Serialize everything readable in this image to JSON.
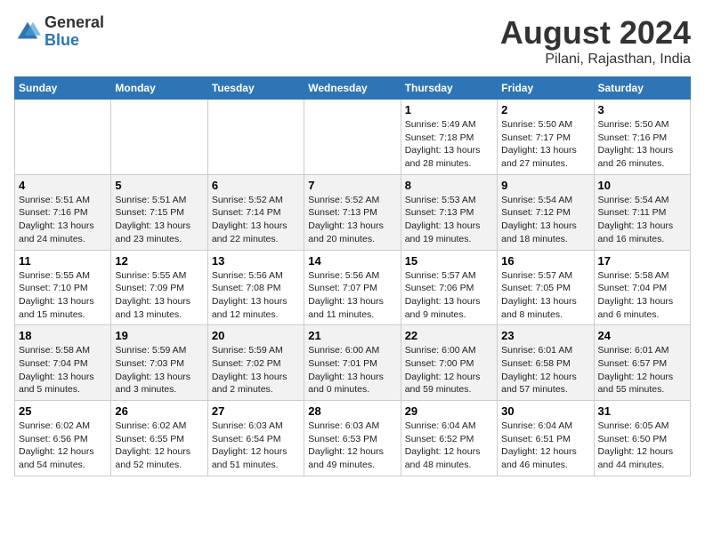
{
  "logo": {
    "general": "General",
    "blue": "Blue"
  },
  "title": "August 2024",
  "subtitle": "Pilani, Rajasthan, India",
  "days_of_week": [
    "Sunday",
    "Monday",
    "Tuesday",
    "Wednesday",
    "Thursday",
    "Friday",
    "Saturday"
  ],
  "weeks": [
    [
      {
        "day": "",
        "content": ""
      },
      {
        "day": "",
        "content": ""
      },
      {
        "day": "",
        "content": ""
      },
      {
        "day": "",
        "content": ""
      },
      {
        "day": "1",
        "content": "Sunrise: 5:49 AM\nSunset: 7:18 PM\nDaylight: 13 hours\nand 28 minutes."
      },
      {
        "day": "2",
        "content": "Sunrise: 5:50 AM\nSunset: 7:17 PM\nDaylight: 13 hours\nand 27 minutes."
      },
      {
        "day": "3",
        "content": "Sunrise: 5:50 AM\nSunset: 7:16 PM\nDaylight: 13 hours\nand 26 minutes."
      }
    ],
    [
      {
        "day": "4",
        "content": "Sunrise: 5:51 AM\nSunset: 7:16 PM\nDaylight: 13 hours\nand 24 minutes."
      },
      {
        "day": "5",
        "content": "Sunrise: 5:51 AM\nSunset: 7:15 PM\nDaylight: 13 hours\nand 23 minutes."
      },
      {
        "day": "6",
        "content": "Sunrise: 5:52 AM\nSunset: 7:14 PM\nDaylight: 13 hours\nand 22 minutes."
      },
      {
        "day": "7",
        "content": "Sunrise: 5:52 AM\nSunset: 7:13 PM\nDaylight: 13 hours\nand 20 minutes."
      },
      {
        "day": "8",
        "content": "Sunrise: 5:53 AM\nSunset: 7:13 PM\nDaylight: 13 hours\nand 19 minutes."
      },
      {
        "day": "9",
        "content": "Sunrise: 5:54 AM\nSunset: 7:12 PM\nDaylight: 13 hours\nand 18 minutes."
      },
      {
        "day": "10",
        "content": "Sunrise: 5:54 AM\nSunset: 7:11 PM\nDaylight: 13 hours\nand 16 minutes."
      }
    ],
    [
      {
        "day": "11",
        "content": "Sunrise: 5:55 AM\nSunset: 7:10 PM\nDaylight: 13 hours\nand 15 minutes."
      },
      {
        "day": "12",
        "content": "Sunrise: 5:55 AM\nSunset: 7:09 PM\nDaylight: 13 hours\nand 13 minutes."
      },
      {
        "day": "13",
        "content": "Sunrise: 5:56 AM\nSunset: 7:08 PM\nDaylight: 13 hours\nand 12 minutes."
      },
      {
        "day": "14",
        "content": "Sunrise: 5:56 AM\nSunset: 7:07 PM\nDaylight: 13 hours\nand 11 minutes."
      },
      {
        "day": "15",
        "content": "Sunrise: 5:57 AM\nSunset: 7:06 PM\nDaylight: 13 hours\nand 9 minutes."
      },
      {
        "day": "16",
        "content": "Sunrise: 5:57 AM\nSunset: 7:05 PM\nDaylight: 13 hours\nand 8 minutes."
      },
      {
        "day": "17",
        "content": "Sunrise: 5:58 AM\nSunset: 7:04 PM\nDaylight: 13 hours\nand 6 minutes."
      }
    ],
    [
      {
        "day": "18",
        "content": "Sunrise: 5:58 AM\nSunset: 7:04 PM\nDaylight: 13 hours\nand 5 minutes."
      },
      {
        "day": "19",
        "content": "Sunrise: 5:59 AM\nSunset: 7:03 PM\nDaylight: 13 hours\nand 3 minutes."
      },
      {
        "day": "20",
        "content": "Sunrise: 5:59 AM\nSunset: 7:02 PM\nDaylight: 13 hours\nand 2 minutes."
      },
      {
        "day": "21",
        "content": "Sunrise: 6:00 AM\nSunset: 7:01 PM\nDaylight: 13 hours\nand 0 minutes."
      },
      {
        "day": "22",
        "content": "Sunrise: 6:00 AM\nSunset: 7:00 PM\nDaylight: 12 hours\nand 59 minutes."
      },
      {
        "day": "23",
        "content": "Sunrise: 6:01 AM\nSunset: 6:58 PM\nDaylight: 12 hours\nand 57 minutes."
      },
      {
        "day": "24",
        "content": "Sunrise: 6:01 AM\nSunset: 6:57 PM\nDaylight: 12 hours\nand 55 minutes."
      }
    ],
    [
      {
        "day": "25",
        "content": "Sunrise: 6:02 AM\nSunset: 6:56 PM\nDaylight: 12 hours\nand 54 minutes."
      },
      {
        "day": "26",
        "content": "Sunrise: 6:02 AM\nSunset: 6:55 PM\nDaylight: 12 hours\nand 52 minutes."
      },
      {
        "day": "27",
        "content": "Sunrise: 6:03 AM\nSunset: 6:54 PM\nDaylight: 12 hours\nand 51 minutes."
      },
      {
        "day": "28",
        "content": "Sunrise: 6:03 AM\nSunset: 6:53 PM\nDaylight: 12 hours\nand 49 minutes."
      },
      {
        "day": "29",
        "content": "Sunrise: 6:04 AM\nSunset: 6:52 PM\nDaylight: 12 hours\nand 48 minutes."
      },
      {
        "day": "30",
        "content": "Sunrise: 6:04 AM\nSunset: 6:51 PM\nDaylight: 12 hours\nand 46 minutes."
      },
      {
        "day": "31",
        "content": "Sunrise: 6:05 AM\nSunset: 6:50 PM\nDaylight: 12 hours\nand 44 minutes."
      }
    ]
  ]
}
